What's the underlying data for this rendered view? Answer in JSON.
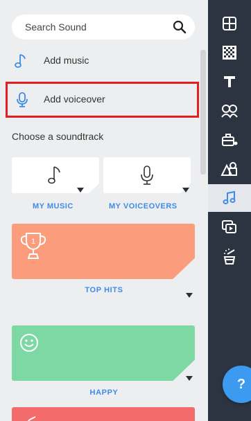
{
  "search": {
    "placeholder": "Search Sound"
  },
  "actions": {
    "add_music": "Add music",
    "add_voiceover": "Add voiceover"
  },
  "soundtrack_heading": "Choose a soundtrack",
  "tiles": [
    {
      "label": "MY MUSIC",
      "icon": "music-note-icon"
    },
    {
      "label": "MY VOICEOVERS",
      "icon": "microphone-icon"
    }
  ],
  "categories": [
    {
      "label": "TOP HITS",
      "color": "#fb9c7c",
      "icon": "trophy-icon",
      "badge": "1"
    },
    {
      "label": "HAPPY",
      "color": "#7ed8a4",
      "icon": "smiley-icon"
    },
    {
      "label": "",
      "color": "#f46b6b",
      "icon": "unknown-icon"
    }
  ],
  "sidebar": {
    "items": [
      {
        "name": "layout-icon"
      },
      {
        "name": "background-pattern-icon"
      },
      {
        "name": "text-icon"
      },
      {
        "name": "characters-icon"
      },
      {
        "name": "props-icon"
      },
      {
        "name": "shapes-icon"
      },
      {
        "name": "music-icon",
        "active": true
      },
      {
        "name": "video-icon"
      },
      {
        "name": "effects-icon"
      }
    ],
    "help_label": "?"
  },
  "colors": {
    "accent": "#3f8be8",
    "highlight_border": "#e0201f",
    "sidebar_bg": "#2b3440"
  }
}
